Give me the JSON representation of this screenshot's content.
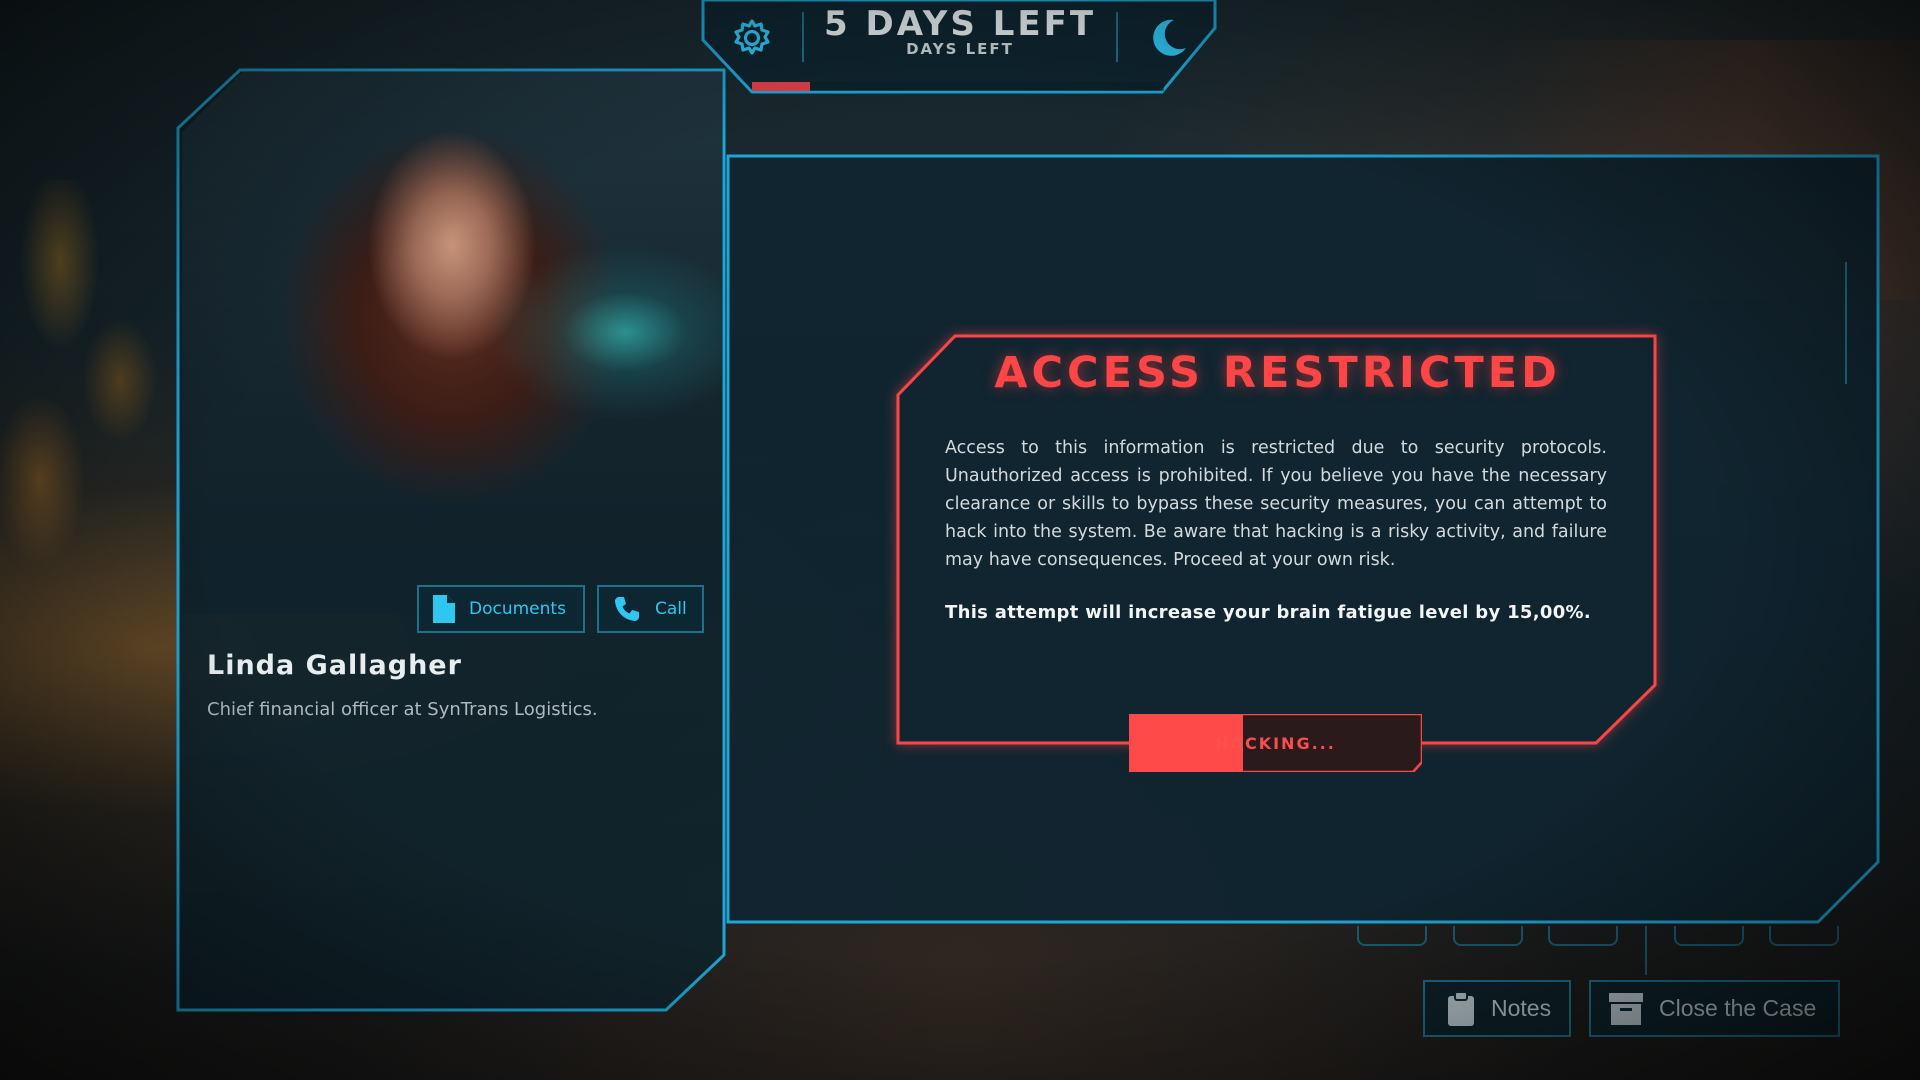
{
  "top_bar": {
    "days_title": "5 DAYS LEFT",
    "days_subtitle": "DAYS LEFT",
    "settings_icon": "gear-icon",
    "sleep_icon": "moon-icon",
    "day_progress": 0.14,
    "progress_color": "#e0404a"
  },
  "profile": {
    "name": "Linda Gallagher",
    "role": "Chief financial officer at SynTrans Logistics.",
    "documents_button": {
      "label": "Documents",
      "icon": "document-icon"
    },
    "call_button": {
      "label": "Call",
      "icon": "phone-icon"
    }
  },
  "access_panel": {
    "title": "ACCESS RESTRICTED",
    "body": "Access to this information is restricted due to security protocols. Unauthorized access is prohibited. If you believe you have the necessary clearance or skills to bypass these security measures, you can attempt to hack into the system. Be aware that hacking is a risky activity, and failure may have consequences. Proceed at your own risk.",
    "note": "This attempt will increase your brain fatigue level by 15,00%.",
    "hack_button": {
      "label": "HACKING...",
      "progress": 0.39
    },
    "accent_color": "#ff4646"
  },
  "bottom_bar": {
    "notes_button": {
      "label": "Notes",
      "icon": "clipboard-icon"
    },
    "close_case_button": {
      "label": "Close the Case",
      "icon": "archive-box-icon"
    }
  },
  "theme": {
    "frame_color": "#1ea6d6",
    "panel_color": "#102530"
  }
}
